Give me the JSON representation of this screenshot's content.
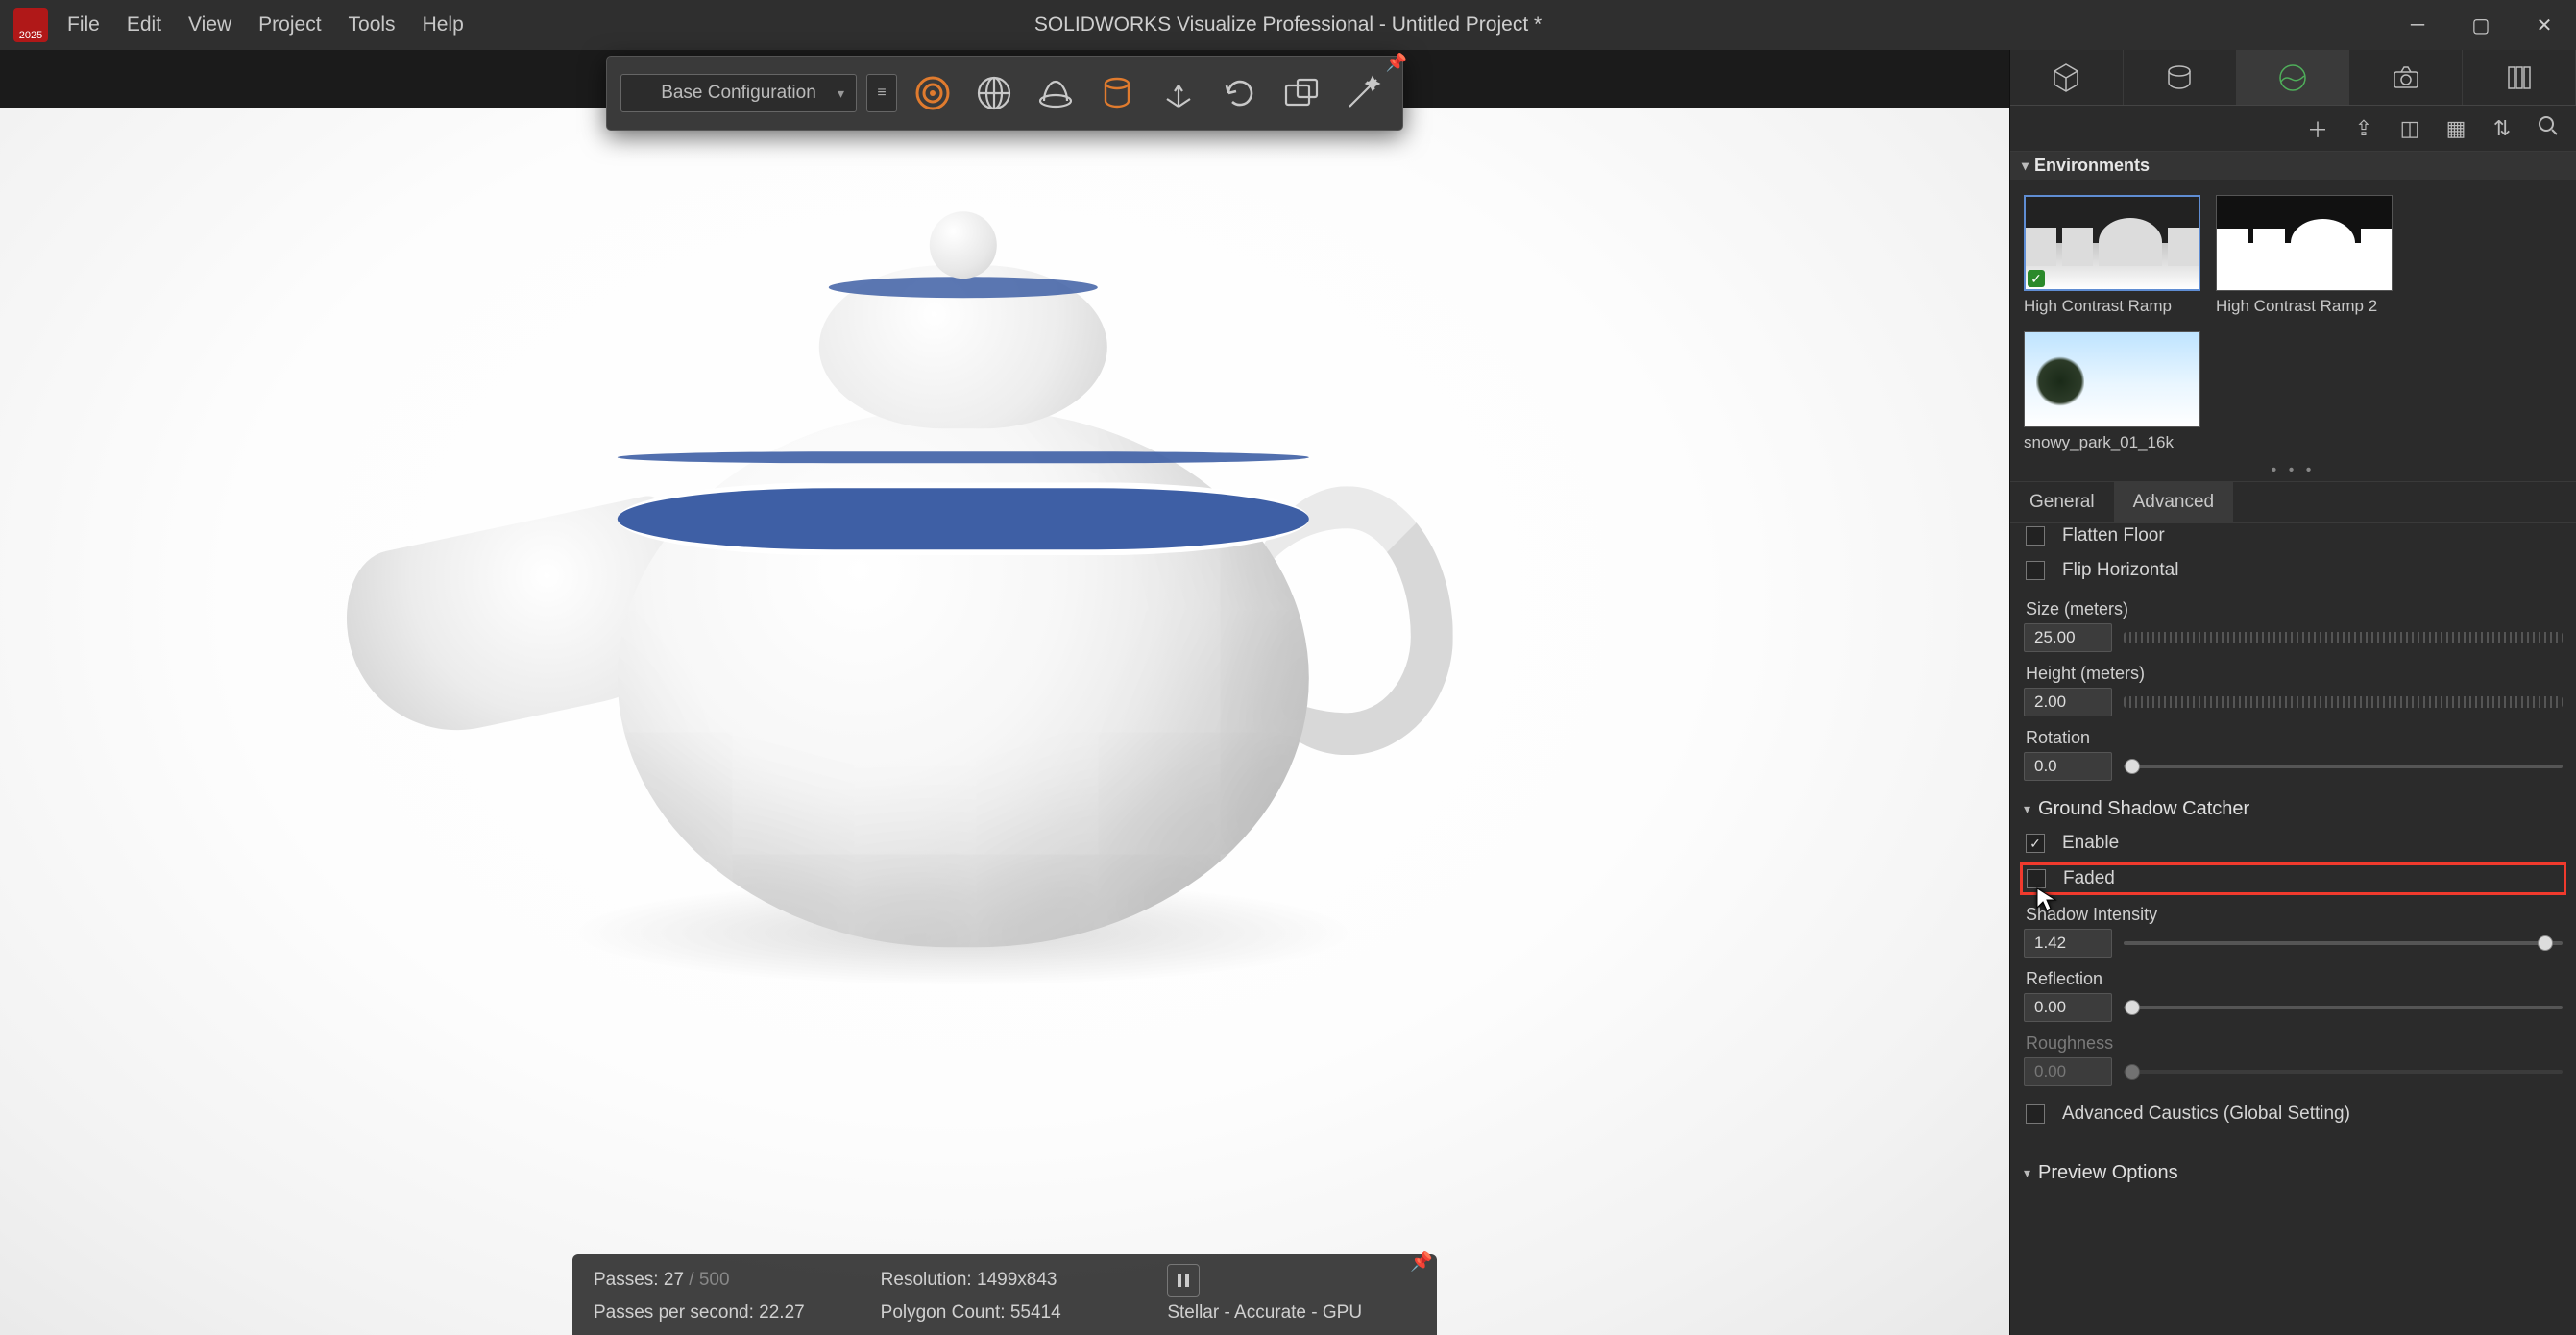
{
  "app": {
    "logo_year": "2025",
    "title": "SOLIDWORKS Visualize Professional - Untitled Project *",
    "menus": [
      "File",
      "Edit",
      "View",
      "Project",
      "Tools",
      "Help"
    ]
  },
  "toolbar": {
    "config_label": "Base Configuration"
  },
  "status": {
    "passes_label": "Passes:",
    "passes_value": "27",
    "passes_sep": "/",
    "passes_total": "500",
    "pps_label": "Passes per second:",
    "pps_value": "22.27",
    "resolution_label": "Resolution:",
    "resolution_value": "1499x843",
    "polycount_label": "Polygon Count:",
    "polycount_value": "55414",
    "renderer": "Stellar - Accurate - GPU"
  },
  "panel": {
    "environments_header": "Environments",
    "envs": [
      {
        "label": "High Contrast Ramp",
        "selected": true
      },
      {
        "label": "High Contrast Ramp 2",
        "selected": false
      },
      {
        "label": "snowy_park_01_16k",
        "selected": false
      }
    ],
    "subtab_general": "General",
    "subtab_advanced": "Advanced",
    "flatten_floor": "Flatten Floor",
    "flip_horizontal": "Flip Horizontal",
    "size_label": "Size (meters)",
    "size_value": "25.00",
    "height_label": "Height (meters)",
    "height_value": "2.00",
    "rotation_label": "Rotation",
    "rotation_value": "0.0",
    "ground_shadow_header": "Ground Shadow Catcher",
    "enable": "Enable",
    "faded": "Faded",
    "shadow_intensity_label": "Shadow Intensity",
    "shadow_intensity_value": "1.42",
    "reflection_label": "Reflection",
    "reflection_value": "0.00",
    "roughness_label": "Roughness",
    "roughness_value": "0.00",
    "advanced_caustics": "Advanced Caustics (Global Setting)",
    "preview_options_header": "Preview Options"
  }
}
